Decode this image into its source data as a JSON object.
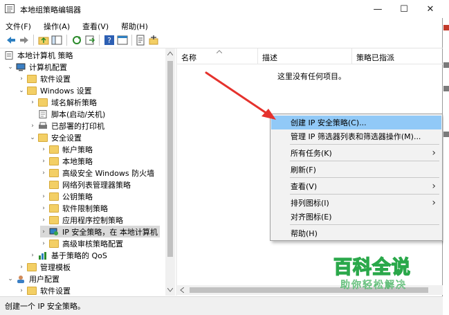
{
  "window": {
    "title": "本地组策略编辑器",
    "controls": {
      "minimize": "—",
      "maximize": "☐",
      "close": "✕"
    }
  },
  "menu": [
    "文件(F)",
    "操作(A)",
    "查看(V)",
    "帮助(H)"
  ],
  "toolbar_icons": [
    "back-icon",
    "forward-icon",
    "up-folder-icon",
    "show-tree-icon",
    "refresh-icon",
    "export-icon",
    "help-icon",
    "properties-icon",
    "assign-icon",
    "unassign-icon"
  ],
  "tree": {
    "items": [
      {
        "label": "本地计算机 策略",
        "depth": 0,
        "chevron": "",
        "icon": "policy-doc-icon"
      },
      {
        "label": "计算机配置",
        "depth": 1,
        "chevron": "⌄",
        "icon": "computer-icon"
      },
      {
        "label": "软件设置",
        "depth": 2,
        "chevron": "›",
        "icon": "folder-icon"
      },
      {
        "label": "Windows 设置",
        "depth": 2,
        "chevron": "⌄",
        "icon": "folder-icon"
      },
      {
        "label": "域名解析策略",
        "depth": 3,
        "chevron": "›",
        "icon": "folder-icon"
      },
      {
        "label": "脚本(启动/关机)",
        "depth": 3,
        "chevron": "",
        "icon": "script-icon"
      },
      {
        "label": "已部署的打印机",
        "depth": 3,
        "chevron": "›",
        "icon": "printer-icon"
      },
      {
        "label": "安全设置",
        "depth": 3,
        "chevron": "⌄",
        "icon": "folder-icon"
      },
      {
        "label": "帐户策略",
        "depth": 4,
        "chevron": "›",
        "icon": "folder-icon"
      },
      {
        "label": "本地策略",
        "depth": 4,
        "chevron": "›",
        "icon": "folder-icon"
      },
      {
        "label": "高级安全 Windows 防火墙",
        "depth": 4,
        "chevron": "›",
        "icon": "folder-icon"
      },
      {
        "label": "网络列表管理器策略",
        "depth": 4,
        "chevron": "",
        "icon": "folder-icon"
      },
      {
        "label": "公钥策略",
        "depth": 4,
        "chevron": "›",
        "icon": "folder-icon"
      },
      {
        "label": "软件限制策略",
        "depth": 4,
        "chevron": "›",
        "icon": "folder-icon"
      },
      {
        "label": "应用程序控制策略",
        "depth": 4,
        "chevron": "›",
        "icon": "folder-icon"
      },
      {
        "label": "IP 安全策略，在 本地计算机",
        "depth": 4,
        "chevron": "›",
        "icon": "ip-security-icon",
        "selected": true
      },
      {
        "label": "高级审核策略配置",
        "depth": 4,
        "chevron": "›",
        "icon": "folder-icon"
      },
      {
        "label": "基于策略的 QoS",
        "depth": 3,
        "chevron": "›",
        "icon": "qos-chart-icon"
      },
      {
        "label": "管理模板",
        "depth": 2,
        "chevron": "›",
        "icon": "folder-icon"
      },
      {
        "label": "用户配置",
        "depth": 1,
        "chevron": "⌄",
        "icon": "user-icon"
      },
      {
        "label": "软件设置",
        "depth": 2,
        "chevron": "›",
        "icon": "folder-icon"
      }
    ]
  },
  "list": {
    "columns": [
      "名称",
      "描述",
      "策略已指派"
    ],
    "empty_message": "这里没有任何项目。"
  },
  "context_menu": {
    "items": [
      {
        "label": "创建 IP 安全策略(C)...",
        "highlighted": true,
        "submenu": false
      },
      {
        "label": "管理 IP 筛选器列表和筛选器操作(M)...",
        "submenu": false
      },
      {
        "separator": true
      },
      {
        "label": "所有任务(K)",
        "submenu": true
      },
      {
        "separator": true
      },
      {
        "label": "刷新(F)",
        "submenu": false
      },
      {
        "separator": true
      },
      {
        "label": "查看(V)",
        "submenu": true
      },
      {
        "separator": true
      },
      {
        "label": "排列图标(I)",
        "submenu": true
      },
      {
        "label": "对齐图标(E)",
        "submenu": false
      },
      {
        "separator": true
      },
      {
        "label": "帮助(H)",
        "submenu": false
      }
    ]
  },
  "status": {
    "text": "创建一个 IP 安全策略。"
  },
  "watermark": {
    "title": "百科全说",
    "subtitle": "助你轻松解决"
  },
  "colors": {
    "highlight": "#91c9f7",
    "arrow": "#e5322d",
    "watermark": "#2aa84a",
    "folder": "#f3cf65"
  }
}
